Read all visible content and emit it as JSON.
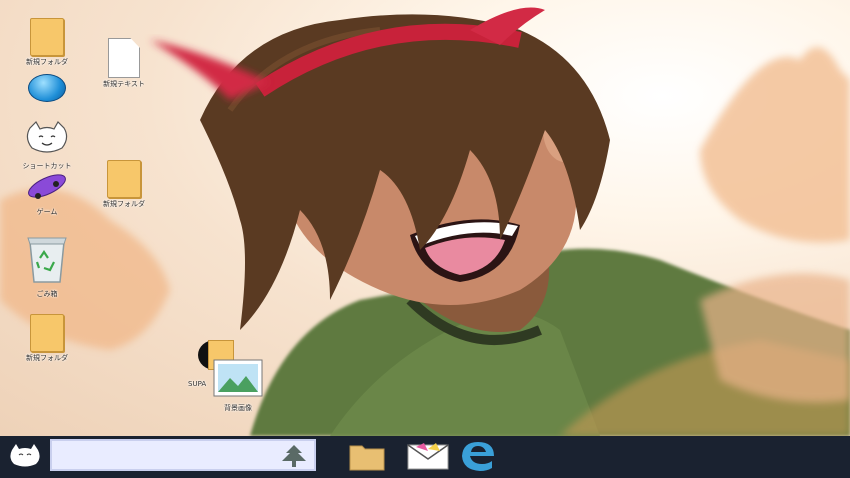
{
  "desktop": {
    "icons": [
      {
        "label": "新規フォルダ"
      },
      {
        "label": "新規テキスト"
      },
      {
        "label": ""
      },
      {
        "label": "ショートカット"
      },
      {
        "label": "新規フォルダ"
      },
      {
        "label": "ゲーム"
      },
      {
        "label": "ごみ箱"
      },
      {
        "label": "新規フォルダ"
      },
      {
        "label": "SUPA"
      },
      {
        "label": "背景画像"
      }
    ]
  },
  "taskbar": {
    "search_placeholder": "",
    "apps": [
      "folder-icon",
      "mail-icon",
      "edge-icon"
    ]
  },
  "colors": {
    "taskbar": "#1a2230",
    "folder": "#f7c76a",
    "search_bg": "#e9ecff"
  }
}
